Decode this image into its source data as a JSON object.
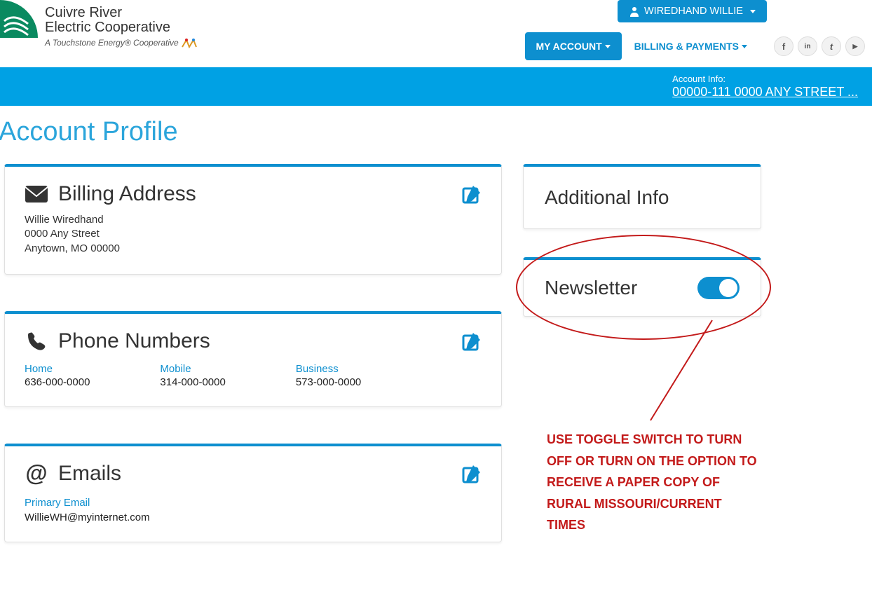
{
  "brand": {
    "line1a": "Cuivre River",
    "line1b": "Electric Cooperative",
    "tagline": "A Touchstone Energy® Cooperative"
  },
  "user_button": {
    "label": "WIREDHAND WILLIE"
  },
  "nav": {
    "my_account": "MY ACCOUNT",
    "billing_payments": "BILLING & PAYMENTS"
  },
  "account_info": {
    "label": "Account Info:",
    "value": "00000-111  0000 ANY STREET ..."
  },
  "page_title": "Account Profile",
  "billing_address": {
    "title": "Billing Address",
    "name": "Willie Wiredhand",
    "street": "0000 Any Street",
    "city_line": "Anytown, MO 00000"
  },
  "phone_numbers": {
    "title": "Phone Numbers",
    "cols": [
      {
        "label": "Home",
        "value": "636-000-0000"
      },
      {
        "label": "Mobile",
        "value": "314-000-0000"
      },
      {
        "label": "Business",
        "value": "573-000-0000"
      }
    ]
  },
  "emails": {
    "title": "Emails",
    "primary_label": "Primary Email",
    "primary_value": "WillieWH@myinternet.com"
  },
  "additional_info": {
    "title": "Additional Info"
  },
  "newsletter": {
    "title": "Newsletter",
    "enabled": true
  },
  "annotation": {
    "text": "USE TOGGLE SWITCH TO TURN OFF OR TURN ON THE OPTION TO RECEIVE A PAPER COPY OF RURAL MISSOURI/CURRENT TIMES"
  },
  "social": {
    "fb": "f",
    "li": "in",
    "tw": "t",
    "yt": "▶"
  }
}
